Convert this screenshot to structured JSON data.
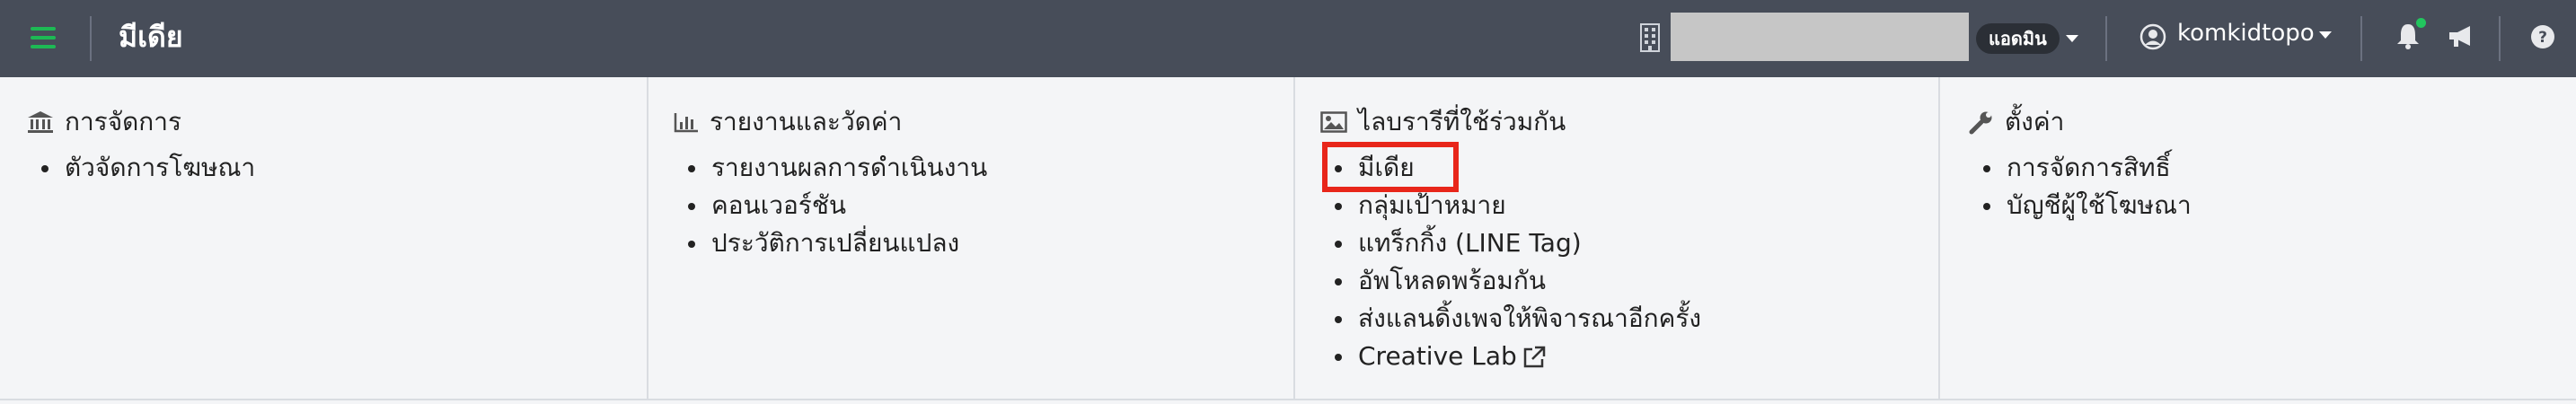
{
  "header": {
    "title": "มีเดีย",
    "role_badge": "แอดมิน",
    "username": "komkidtopo"
  },
  "menu": {
    "management": {
      "title": "การจัดการ",
      "items": [
        "ตัวจัดการโฆษณา"
      ]
    },
    "reports": {
      "title": "รายงานและวัดค่า",
      "items": [
        "รายงานผลการดำเนินงาน",
        "คอนเวอร์ชัน",
        "ประวัติการเปลี่ยนแปลง"
      ]
    },
    "library": {
      "title": "ไลบรารีที่ใช้ร่วมกัน",
      "items": [
        "มีเดีย",
        "กลุ่มเป้าหมาย",
        "แทร็กกิ้ง (LINE Tag)",
        "อัพโหลดพร้อมกัน",
        "ส่งแลนดิ้งเพจให้พิจารณาอีกครั้ง",
        "Creative Lab"
      ]
    },
    "settings": {
      "title": "ตั้งค่า",
      "items": [
        "การจัดการสิทธิ์",
        "บัญชีผู้ใช้โฆษณา"
      ]
    }
  },
  "colors": {
    "topbar": "#474d59",
    "accent_green": "#1db954",
    "highlight_red": "#e8261a"
  },
  "icons": {
    "menu": "hamburger-icon",
    "building": "building-icon",
    "user": "user-circle-icon",
    "bell": "bell-icon",
    "announce": "megaphone-icon",
    "help": "question-circle-icon",
    "management": "bank-icon",
    "reports": "bar-chart-icon",
    "library": "image-icon",
    "settings": "wrench-icon",
    "external": "external-link-icon"
  }
}
